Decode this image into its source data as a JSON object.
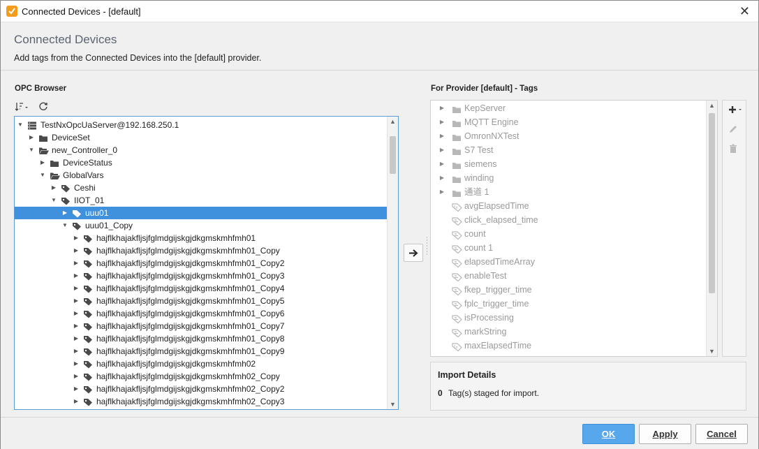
{
  "window": {
    "title": "Connected Devices - [default]"
  },
  "header": {
    "title": "Connected Devices",
    "description": "Add tags from the Connected Devices into the [default] provider."
  },
  "opc_browser": {
    "label": "OPC Browser",
    "rows": [
      {
        "label": "TestNxOpcUaServer@192.168.250.1",
        "depth": 0,
        "expanded": true,
        "icon": "server-icon"
      },
      {
        "label": "DeviceSet",
        "depth": 1,
        "expanded": false,
        "icon": "folder-icon"
      },
      {
        "label": "new_Controller_0",
        "depth": 1,
        "expanded": true,
        "icon": "folder-open-icon"
      },
      {
        "label": "DeviceStatus",
        "depth": 2,
        "expanded": false,
        "icon": "folder-icon"
      },
      {
        "label": "GlobalVars",
        "depth": 2,
        "expanded": true,
        "icon": "folder-open-icon"
      },
      {
        "label": "Ceshi",
        "depth": 3,
        "expanded": false,
        "icon": "tag-icon"
      },
      {
        "label": "IIOT_01",
        "depth": 3,
        "expanded": true,
        "icon": "tag-icon"
      },
      {
        "label": "uuu01",
        "depth": 4,
        "expanded": false,
        "icon": "tag-icon",
        "selected": true
      },
      {
        "label": "uuu01_Copy",
        "depth": 4,
        "expanded": true,
        "icon": "tag-icon"
      },
      {
        "label": "hajflkhajakfljsjfglmdgijskgjdkgmskmhfmh01",
        "depth": 5,
        "expanded": false,
        "icon": "tag-icon"
      },
      {
        "label": "hajflkhajakfljsjfglmdgijskgjdkgmskmhfmh01_Copy",
        "depth": 5,
        "expanded": false,
        "icon": "tag-icon"
      },
      {
        "label": "hajflkhajakfljsjfglmdgijskgjdkgmskmhfmh01_Copy2",
        "depth": 5,
        "expanded": false,
        "icon": "tag-icon"
      },
      {
        "label": "hajflkhajakfljsjfglmdgijskgjdkgmskmhfmh01_Copy3",
        "depth": 5,
        "expanded": false,
        "icon": "tag-icon"
      },
      {
        "label": "hajflkhajakfljsjfglmdgijskgjdkgmskmhfmh01_Copy4",
        "depth": 5,
        "expanded": false,
        "icon": "tag-icon"
      },
      {
        "label": "hajflkhajakfljsjfglmdgijskgjdkgmskmhfmh01_Copy5",
        "depth": 5,
        "expanded": false,
        "icon": "tag-icon"
      },
      {
        "label": "hajflkhajakfljsjfglmdgijskgjdkgmskmhfmh01_Copy6",
        "depth": 5,
        "expanded": false,
        "icon": "tag-icon"
      },
      {
        "label": "hajflkhajakfljsjfglmdgijskgjdkgmskmhfmh01_Copy7",
        "depth": 5,
        "expanded": false,
        "icon": "tag-icon"
      },
      {
        "label": "hajflkhajakfljsjfglmdgijskgjdkgmskmhfmh01_Copy8",
        "depth": 5,
        "expanded": false,
        "icon": "tag-icon"
      },
      {
        "label": "hajflkhajakfljsjfglmdgijskgjdkgmskmhfmh01_Copy9",
        "depth": 5,
        "expanded": false,
        "icon": "tag-icon"
      },
      {
        "label": "hajflkhajakfljsjfglmdgijskgjdkgmskmhfmh02",
        "depth": 5,
        "expanded": false,
        "icon": "tag-icon"
      },
      {
        "label": "hajflkhajakfljsjfglmdgijskgjdkgmskmhfmh02_Copy",
        "depth": 5,
        "expanded": false,
        "icon": "tag-icon"
      },
      {
        "label": "hajflkhajakfljsjfglmdgijskgjdkgmskmhfmh02_Copy2",
        "depth": 5,
        "expanded": false,
        "icon": "tag-icon"
      },
      {
        "label": "hajflkhajakfljsjfglmdgijskgjdkgmskmhfmh02_Copy3",
        "depth": 5,
        "expanded": false,
        "icon": "tag-icon"
      }
    ]
  },
  "provider": {
    "label": "For Provider [default] - Tags",
    "rows": [
      {
        "label": "KepServer",
        "type": "folder"
      },
      {
        "label": "MQTT Engine",
        "type": "folder"
      },
      {
        "label": "OmronNXTest",
        "type": "folder"
      },
      {
        "label": "S7 Test",
        "type": "folder"
      },
      {
        "label": "siemens",
        "type": "folder"
      },
      {
        "label": "winding",
        "type": "folder"
      },
      {
        "label": "通道 1",
        "type": "folder"
      },
      {
        "label": "avgElapsedTime",
        "type": "expr-tag"
      },
      {
        "label": "click_elapsed_time",
        "type": "memory-tag"
      },
      {
        "label": "count",
        "type": "memory-tag"
      },
      {
        "label": "count 1",
        "type": "memory-tag"
      },
      {
        "label": "elapsedTimeArray",
        "type": "memory-tag"
      },
      {
        "label": "enableTest",
        "type": "memory-tag"
      },
      {
        "label": "fkep_trigger_time",
        "type": "memory-tag"
      },
      {
        "label": "fplc_trigger_time",
        "type": "memory-tag"
      },
      {
        "label": "isProcessing",
        "type": "memory-tag"
      },
      {
        "label": "markString",
        "type": "memory-tag"
      },
      {
        "label": "maxElapsedTime",
        "type": "expr-tag"
      }
    ]
  },
  "import_details": {
    "title": "Import Details",
    "count": "0",
    "text": "Tag(s) staged for import."
  },
  "footer": {
    "ok_label": "OK",
    "apply_label": "Apply",
    "cancel_label": "Cancel"
  }
}
